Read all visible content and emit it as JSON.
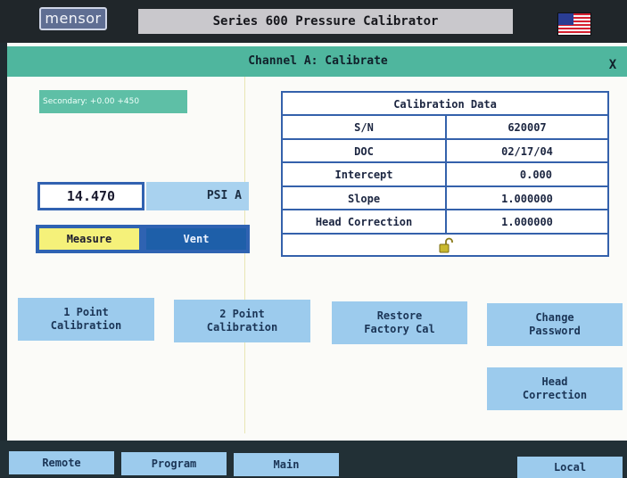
{
  "header": {
    "logo_text": "mensor",
    "title": "Series 600 Pressure Calibrator",
    "flag_icon": "us-flag-icon"
  },
  "panel": {
    "title": "Channel A: Calibrate",
    "close_label": "X"
  },
  "secondary": {
    "label": "Secondary: +0.00 +450"
  },
  "reading": {
    "value": "14.470",
    "unit": "PSI A"
  },
  "mode": {
    "measure_label": "Measure",
    "vent_label": "Vent",
    "active": "Measure"
  },
  "calibration_data": {
    "title": "Calibration Data",
    "rows": [
      {
        "label": "S/N",
        "value": "620007"
      },
      {
        "label": "DOC",
        "value": "02/17/04"
      },
      {
        "label": "Intercept",
        "value": "0.000"
      },
      {
        "label": "Slope",
        "value": "1.000000"
      },
      {
        "label": "Head Correction",
        "value": "1.000000"
      }
    ],
    "lock_icon": "unlocked-padlock-icon"
  },
  "actions": {
    "one_point": [
      "1 Point",
      "Calibration"
    ],
    "two_point": [
      "2 Point",
      "Calibration"
    ],
    "restore": [
      "Restore",
      "Factory Cal"
    ],
    "change_password": [
      "Change",
      "Password"
    ],
    "head_correction": [
      "Head",
      "Correction"
    ]
  },
  "bottom_bar": {
    "remote": "Remote",
    "program": "Program",
    "main": "Main",
    "local": "Local"
  },
  "colors": {
    "title_bar": "#4fb69e",
    "button": "#9ccbed",
    "border_blue": "#3461ab",
    "measure_active": "#f5f17a",
    "vent": "#1e5fa9"
  }
}
